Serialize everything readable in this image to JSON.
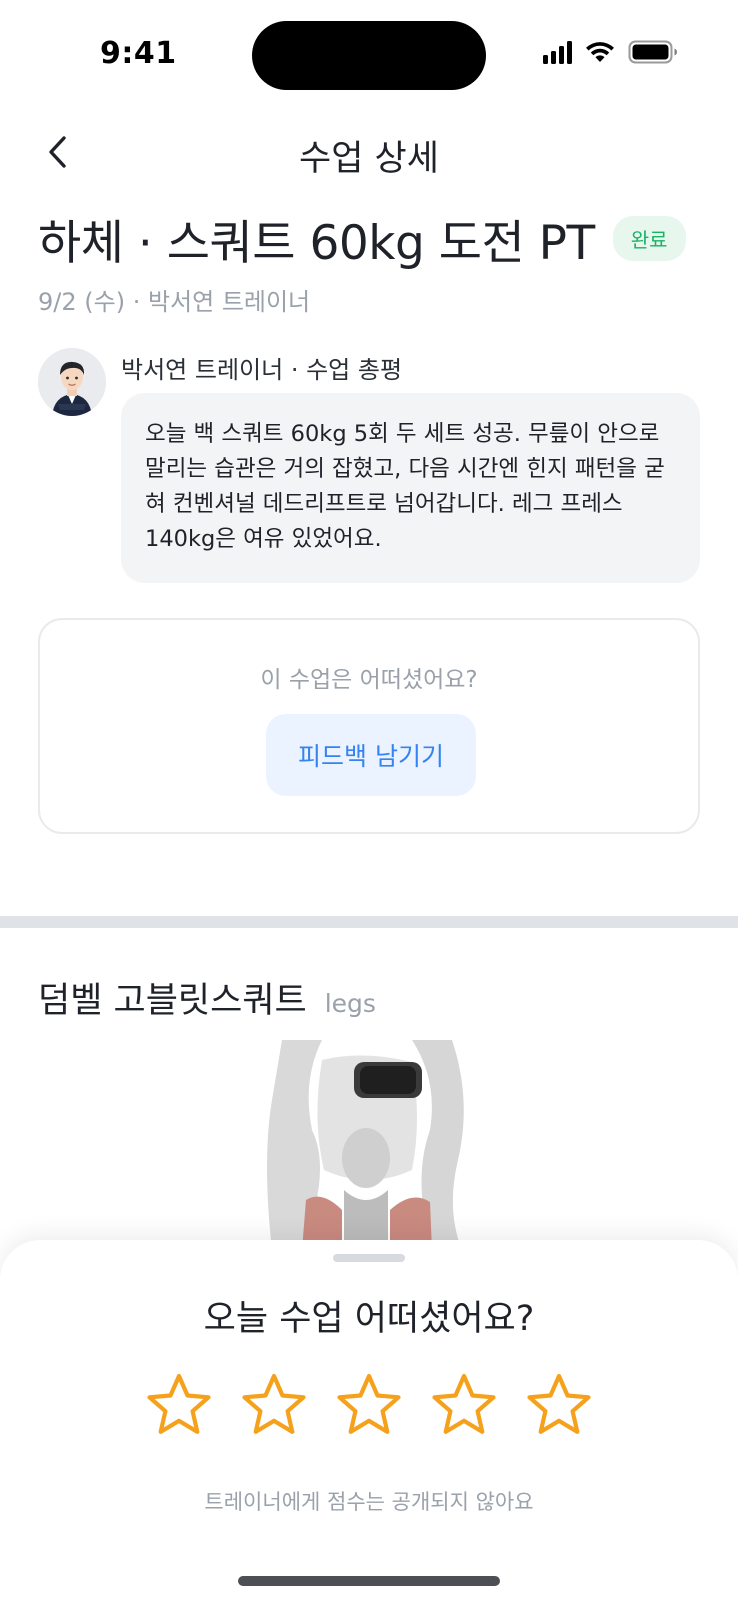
{
  "status_bar": {
    "time": "9:41"
  },
  "nav": {
    "title": "수업 상세",
    "back_icon": "chevron-left-icon"
  },
  "class": {
    "title": "하체 · 스쿼트 60kg 도전 PT",
    "status": "완료",
    "status_color": "#1bb264",
    "meta": "9/2 (수) · 박서연 트레이너"
  },
  "review": {
    "label": "박서연 트레이너 · 수업 총평",
    "body": "오늘 백 스쿼트 60kg 5회 두 세트 성공. 무릎이 안으로 말리는 습관은 거의 잡혔고, 다음 시간엔 힌지 패턴을 굳혀 컨벤셔널 데드리프트로 넘어갑니다. 레그 프레스 140kg은 여유 있었어요."
  },
  "feedback": {
    "question": "이 수업은 어떠셨어요?",
    "button_label": "피드백 남기기",
    "button_color": "#3583f0"
  },
  "exercise": {
    "name": "덤벨 고블릿스쿼트",
    "tag": "legs"
  },
  "rating_sheet": {
    "title": "오늘 수업 어떠셨어요?",
    "stars_total": 5,
    "stars_selected": 0,
    "star_color": "#f5a11c",
    "note": "트레이너에게 점수는 공개되지 않아요"
  }
}
